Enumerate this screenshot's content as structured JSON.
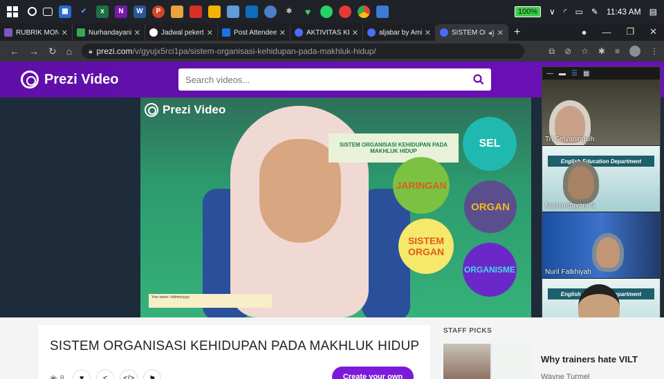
{
  "taskbar": {
    "battery": "100%",
    "time": "11:43 AM"
  },
  "browser": {
    "tabs": [
      {
        "label": "RUBRIK MONIT",
        "color": "#7e57c2"
      },
      {
        "label": "Nurhandayani",
        "color": "#34a853"
      },
      {
        "label": "Jadwal pekerti",
        "color": "#ffffff"
      },
      {
        "label": "Post Attendee",
        "color": "#1a73e8"
      },
      {
        "label": "AKTIVITAS KEI",
        "color": "#4a6cf7"
      },
      {
        "label": "aljabar by Ami",
        "color": "#4a6cf7"
      },
      {
        "label": "SISTEM OI",
        "color": "#4a6cf7"
      }
    ],
    "url_host": "prezi.com",
    "url_path": "/v/gyujx5rci1pa/sistem-organisasi-kehidupan-pada-makhluk-hidup/"
  },
  "header": {
    "brand": "Prezi Video",
    "search_placeholder": "Search videos...",
    "accent": "#6a0dad"
  },
  "video": {
    "brand": "Prezi Video",
    "slide_title": "SISTEM ORGANISASI KEHIDUPAN PADA MAKHLUK HIDUP",
    "name_card": "Your name / dd/mm/yyyy",
    "circles": {
      "sel": "SEL",
      "jaringan": "JARINGAN",
      "organ": "ORGAN",
      "sistem_organ": "SISTEM ORGAN",
      "organisme": "ORGANISME"
    }
  },
  "participants": [
    {
      "name": "Tri Setyaningsih"
    },
    {
      "name": "Nurhandayani S",
      "banner": "English Education Department"
    },
    {
      "name": "Nuril Fatkhiyah"
    },
    {
      "name": "",
      "banner": "English Education Department"
    }
  ],
  "content": {
    "video_title": "SISTEM ORGANISASI KEHIDUPAN PADA MAKHLUK HIDUP",
    "views": "8",
    "create_button": "Create your own",
    "staff_picks_label": "STAFF PICKS",
    "staff_pick_title": "Why trainers hate VILT",
    "staff_pick_author": "Wayne Turmel"
  }
}
